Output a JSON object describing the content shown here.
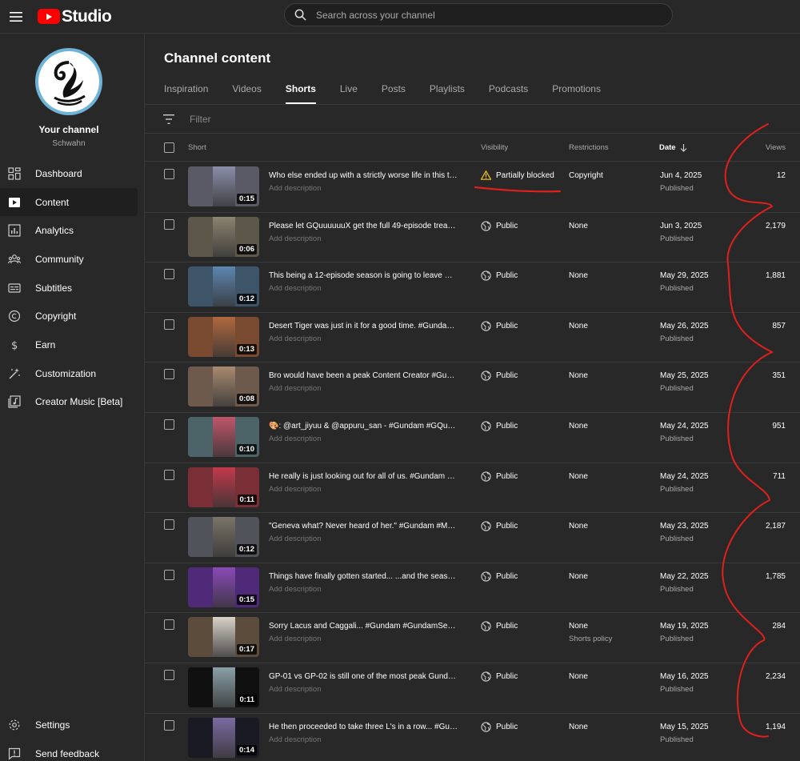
{
  "header": {
    "app_name": "Studio",
    "search_placeholder": "Search across your channel"
  },
  "sidebar": {
    "channel_name": "Your channel",
    "channel_handle": "Schwahn",
    "items": [
      {
        "label": "Dashboard",
        "icon": "dashboard-icon"
      },
      {
        "label": "Content",
        "icon": "content-icon",
        "active": true
      },
      {
        "label": "Analytics",
        "icon": "analytics-icon"
      },
      {
        "label": "Community",
        "icon": "community-icon"
      },
      {
        "label": "Subtitles",
        "icon": "subtitles-icon"
      },
      {
        "label": "Copyright",
        "icon": "copyright-icon"
      },
      {
        "label": "Earn",
        "icon": "earn-icon"
      },
      {
        "label": "Customization",
        "icon": "customization-icon"
      },
      {
        "label": "Creator Music [Beta]",
        "icon": "creator-music-icon"
      }
    ],
    "bottom_items": [
      {
        "label": "Settings",
        "icon": "gear-icon"
      },
      {
        "label": "Send feedback",
        "icon": "feedback-icon"
      }
    ]
  },
  "main": {
    "title": "Channel content",
    "tabs": [
      "Inspiration",
      "Videos",
      "Shorts",
      "Live",
      "Posts",
      "Playlists",
      "Podcasts",
      "Promotions"
    ],
    "active_tab": "Shorts",
    "filter_placeholder": "Filter",
    "columns": {
      "short": "Short",
      "visibility": "Visibility",
      "restrictions": "Restrictions",
      "date": "Date",
      "views": "Views"
    },
    "rows": [
      {
        "duration": "0:15",
        "title": "Who else ended up with a strictly worse life in this ti...",
        "desc": "Add description",
        "visibility": "Partially blocked",
        "vis_icon": "warning-icon",
        "restriction": "Copyright",
        "restriction_sub": "",
        "date": "Jun 4, 2025",
        "status": "Published",
        "views": "12",
        "thumb_color": "#5a5a66",
        "pic_color": "#8a8fa8"
      },
      {
        "duration": "0:06",
        "title": "Please let GQuuuuuuX get the full 49-episode treatm...",
        "desc": "Add description",
        "visibility": "Public",
        "vis_icon": "globe-icon",
        "restriction": "None",
        "restriction_sub": "",
        "date": "Jun 3, 2025",
        "status": "Published",
        "views": "2,179",
        "thumb_color": "#5d574a",
        "pic_color": "#8c8370"
      },
      {
        "duration": "0:12",
        "title": "This being a 12-episode season is going to leave me ...",
        "desc": "Add description",
        "visibility": "Public",
        "vis_icon": "globe-icon",
        "restriction": "None",
        "restriction_sub": "",
        "date": "May 29, 2025",
        "status": "Published",
        "views": "1,881",
        "thumb_color": "#3e5468",
        "pic_color": "#5d86b0"
      },
      {
        "duration": "0:13",
        "title": "Desert Tiger was just in it for a good time. #Gundam ...",
        "desc": "Add description",
        "visibility": "Public",
        "vis_icon": "globe-icon",
        "restriction": "None",
        "restriction_sub": "",
        "date": "May 26, 2025",
        "status": "Published",
        "views": "857",
        "thumb_color": "#7a4a30",
        "pic_color": "#b0683f"
      },
      {
        "duration": "0:08",
        "title": "Bro would have been a peak Content Creator #Gunda...",
        "desc": "Add description",
        "visibility": "Public",
        "vis_icon": "globe-icon",
        "restriction": "None",
        "restriction_sub": "",
        "date": "May 25, 2025",
        "status": "Published",
        "views": "351",
        "thumb_color": "#6e5a4c",
        "pic_color": "#a88a70"
      },
      {
        "duration": "0:10",
        "title": "🎨: @art_jiyuu & @appuru_san - #Gundam #GQuuuu...",
        "desc": "Add description",
        "visibility": "Public",
        "vis_icon": "globe-icon",
        "restriction": "None",
        "restriction_sub": "",
        "date": "May 24, 2025",
        "status": "Published",
        "views": "951",
        "thumb_color": "#4c6468",
        "pic_color": "#c0566a"
      },
      {
        "duration": "0:11",
        "title": "He really is just looking out for all of us. #Gundam #...",
        "desc": "Add description",
        "visibility": "Public",
        "vis_icon": "globe-icon",
        "restriction": "None",
        "restriction_sub": "",
        "date": "May 24, 2025",
        "status": "Published",
        "views": "711",
        "thumb_color": "#7a2e36",
        "pic_color": "#c23a4c"
      },
      {
        "duration": "0:12",
        "title": "\"Geneva what? Never heard of her.\" #Gundam #Mobil...",
        "desc": "Add description",
        "visibility": "Public",
        "vis_icon": "globe-icon",
        "restriction": "None",
        "restriction_sub": "",
        "date": "May 23, 2025",
        "status": "Published",
        "views": "2,187",
        "thumb_color": "#50535a",
        "pic_color": "#7a7468"
      },
      {
        "duration": "0:15",
        "title": "Things have finally gotten started... ...and the season...",
        "desc": "Add description",
        "visibility": "Public",
        "vis_icon": "globe-icon",
        "restriction": "None",
        "restriction_sub": "",
        "date": "May 22, 2025",
        "status": "Published",
        "views": "1,785",
        "thumb_color": "#4e2a78",
        "pic_color": "#8a4ab8"
      },
      {
        "duration": "0:17",
        "title": "Sorry Lacus and Caggali... #Gundam #GundamSeed ...",
        "desc": "Add description",
        "visibility": "Public",
        "vis_icon": "globe-icon",
        "restriction": "None",
        "restriction_sub": "Shorts policy",
        "date": "May 19, 2025",
        "status": "Published",
        "views": "284",
        "thumb_color": "#5c4c3c",
        "pic_color": "#d8d2c8"
      },
      {
        "duration": "0:11",
        "title": "GP-01 vs GP-02 is still one of the most peak Gundam...",
        "desc": "Add description",
        "visibility": "Public",
        "vis_icon": "globe-icon",
        "restriction": "None",
        "restriction_sub": "",
        "date": "May 16, 2025",
        "status": "Published",
        "views": "2,234",
        "thumb_color": "#101010",
        "pic_color": "#8aa0a8"
      },
      {
        "duration": "0:14",
        "title": "He then proceeded to take three L's in a row... #Gund...",
        "desc": "Add description",
        "visibility": "Public",
        "vis_icon": "globe-icon",
        "restriction": "None",
        "restriction_sub": "",
        "date": "May 15, 2025",
        "status": "Published",
        "views": "1,194",
        "thumb_color": "#1a1a24",
        "pic_color": "#7a6aa0"
      }
    ]
  },
  "colors": {
    "background": "#282828",
    "brand_red": "#ff0000",
    "annotation_red": "#e0201c",
    "warning_yellow": "#f5c518"
  }
}
